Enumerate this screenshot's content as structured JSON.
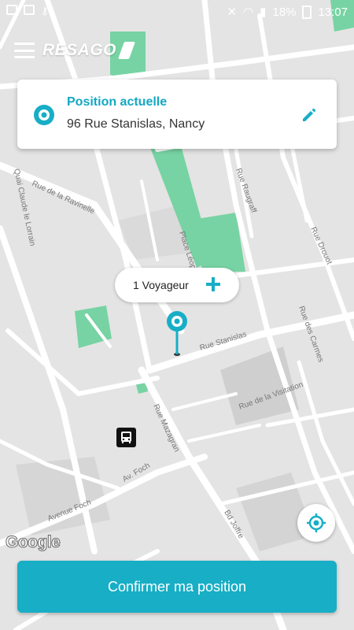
{
  "status_bar": {
    "battery": "18%",
    "time": "13:07"
  },
  "app": {
    "logo_text": "RESAGO"
  },
  "location_card": {
    "title": "Position actuelle",
    "address": "96 Rue Stanislas, Nancy"
  },
  "passengers": {
    "label": "1 Voyageur"
  },
  "map": {
    "attribution": "Google",
    "streets": {
      "rue_stanislas": "Rue Stanislas",
      "avenue_foch": "Avenue Foch",
      "av_foch": "Av. Foch",
      "rue_mazagran": "Rue Mazagran",
      "bd_joffre": "Bd Joffre",
      "quai_claude_le_lorrain": "Quai Claude le Lorrain",
      "place_leopold": "Place Léopold",
      "rue_de_la_visitation": "Rue de la Visitation",
      "rue_des_carmes": "Rue des Carmes",
      "rue_drouot": "Rue Drouot",
      "rue_raugraff": "Rue Raugraff",
      "rue_de_la_ravinelle": "Rue de la Ravinelle"
    }
  },
  "actions": {
    "confirm_label": "Confirmer ma position"
  },
  "colors": {
    "accent": "#17aec6",
    "park_green": "#77d3a3",
    "map_background": "#e4e4e4",
    "road": "#ffffff"
  }
}
